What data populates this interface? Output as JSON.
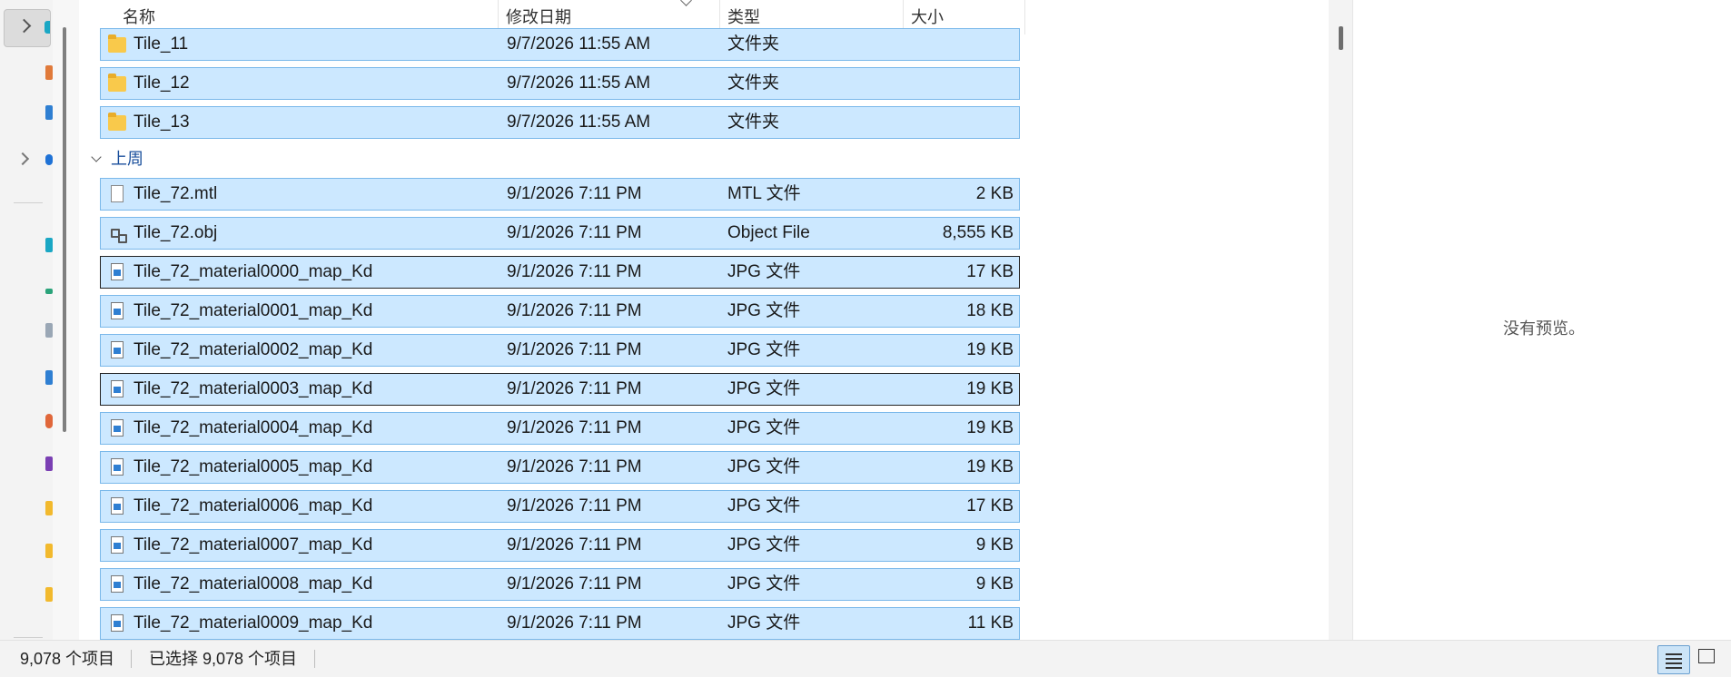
{
  "columns": {
    "name": "名称",
    "date": "修改日期",
    "type": "类型",
    "size": "大小"
  },
  "group_lastweek": "上周",
  "rows": [
    {
      "name": "Tile_11",
      "date": "9/7/2026 11:55 AM",
      "type": "文件夹",
      "size": "",
      "icon": "folder-icon"
    },
    {
      "name": "Tile_12",
      "date": "9/7/2026 11:55 AM",
      "type": "文件夹",
      "size": "",
      "icon": "folder-icon"
    },
    {
      "name": "Tile_13",
      "date": "9/7/2026 11:55 AM",
      "type": "文件夹",
      "size": "",
      "icon": "folder-icon"
    },
    {
      "name": "Tile_72.mtl",
      "date": "9/1/2026 7:11 PM",
      "type": "MTL 文件",
      "size": "2 KB",
      "icon": "file-icon"
    },
    {
      "name": "Tile_72.obj",
      "date": "9/1/2026 7:11 PM",
      "type": "Object File",
      "size": "8,555 KB",
      "icon": "3d-object-icon"
    },
    {
      "name": "Tile_72_material0000_map_Kd",
      "date": "9/1/2026 7:11 PM",
      "type": "JPG 文件",
      "size": "17 KB",
      "icon": "image-file-icon"
    },
    {
      "name": "Tile_72_material0001_map_Kd",
      "date": "9/1/2026 7:11 PM",
      "type": "JPG 文件",
      "size": "18 KB",
      "icon": "image-file-icon"
    },
    {
      "name": "Tile_72_material0002_map_Kd",
      "date": "9/1/2026 7:11 PM",
      "type": "JPG 文件",
      "size": "19 KB",
      "icon": "image-file-icon"
    },
    {
      "name": "Tile_72_material0003_map_Kd",
      "date": "9/1/2026 7:11 PM",
      "type": "JPG 文件",
      "size": "19 KB",
      "icon": "image-file-icon"
    },
    {
      "name": "Tile_72_material0004_map_Kd",
      "date": "9/1/2026 7:11 PM",
      "type": "JPG 文件",
      "size": "19 KB",
      "icon": "image-file-icon"
    },
    {
      "name": "Tile_72_material0005_map_Kd",
      "date": "9/1/2026 7:11 PM",
      "type": "JPG 文件",
      "size": "19 KB",
      "icon": "image-file-icon"
    },
    {
      "name": "Tile_72_material0006_map_Kd",
      "date": "9/1/2026 7:11 PM",
      "type": "JPG 文件",
      "size": "17 KB",
      "icon": "image-file-icon"
    },
    {
      "name": "Tile_72_material0007_map_Kd",
      "date": "9/1/2026 7:11 PM",
      "type": "JPG 文件",
      "size": "9 KB",
      "icon": "image-file-icon"
    },
    {
      "name": "Tile_72_material0008_map_Kd",
      "date": "9/1/2026 7:11 PM",
      "type": "JPG 文件",
      "size": "9 KB",
      "icon": "image-file-icon"
    },
    {
      "name": "Tile_72_material0009_map_Kd",
      "date": "9/1/2026 7:11 PM",
      "type": "JPG 文件",
      "size": "11 KB",
      "icon": "image-file-icon"
    }
  ],
  "preview_text": "没有预览。",
  "status": {
    "item_count": "9,078 个项目",
    "selected": "已选择 9,078 个项目"
  },
  "colors": {
    "selection_fill": "#cce8ff",
    "selection_border": "#7ab8ea",
    "group_header": "#1a4f9c"
  }
}
